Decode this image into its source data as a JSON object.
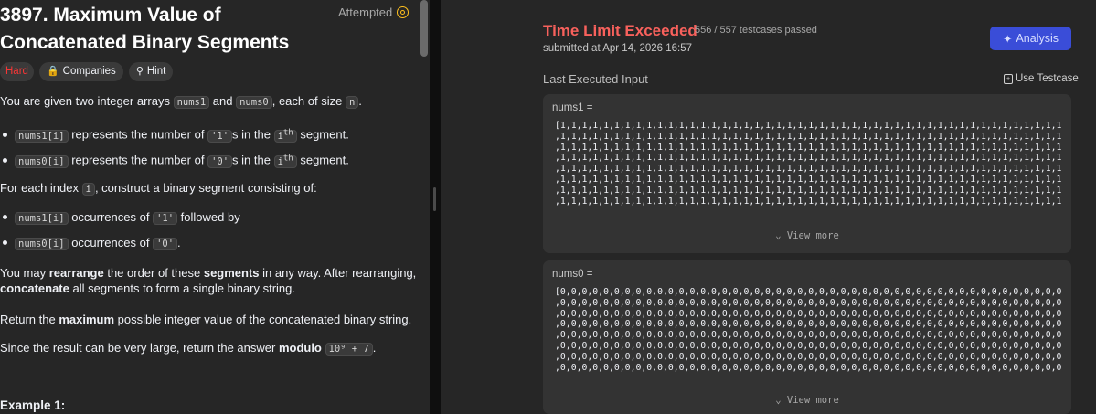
{
  "problem": {
    "title": "3897. Maximum Value of Concatenated Binary Segments",
    "attempted": "Attempted",
    "tags": {
      "difficulty": "Hard",
      "companies": "Companies",
      "hint": "Hint"
    },
    "desc": {
      "p1_a": "You are given two integer arrays ",
      "p1_code1": "nums1",
      "p1_b": " and ",
      "p1_code2": "nums0",
      "p1_c": ", each of size ",
      "p1_code3": "n",
      "p1_d": ".",
      "b1_code": "nums1[i]",
      "b1_a": " represents the number of ",
      "b1_code2": "'1'",
      "b1_b": "s in the ",
      "b1_code3": "i",
      "b1_sup": "th",
      "b1_c": " segment.",
      "b2_code": "nums0[i]",
      "b2_a": " represents the number of ",
      "b2_code2": "'0'",
      "b2_b": "s in the ",
      "b2_code3": "i",
      "b2_sup": "th",
      "b2_c": " segment.",
      "p2_a": "For each index ",
      "p2_code": "i",
      "p2_b": ", construct a binary segment consisting of:",
      "b3_code": "nums1[i]",
      "b3_a": " occurrences of ",
      "b3_code2": "'1'",
      "b3_b": " followed by",
      "b4_code": "nums0[i]",
      "b4_a": " occurrences of ",
      "b4_code2": "'0'",
      "b4_b": ".",
      "p3_a": "You may ",
      "p3_bold1": "rearrange",
      "p3_b": " the order of these ",
      "p3_bold2": "segments",
      "p3_c": " in any way. After rearranging,",
      "p3_bold3": "concatenate",
      "p3_d": " all segments to form a single binary string.",
      "p4_a": "Return the ",
      "p4_bold": "maximum",
      "p4_b": " possible integer value of the concatenated binary string.",
      "p5_a": "Since the result can be very large, return the answer ",
      "p5_bold": "modulo",
      "p5_code": "10⁹ + 7",
      "p5_b": "."
    },
    "example": "Example 1:"
  },
  "result": {
    "status": "Time Limit Exceeded",
    "passed": "556 / 557 testcases passed",
    "submitted": "submitted at Apr 14, 2026 16:57",
    "analysis": "Analysis",
    "last_input": "Last Executed Input",
    "use_testcase": "Use Testcase",
    "nums1_label": "nums1 =",
    "nums1_lines": [
      "[1,1,1,1,1,1,1,1,1,1,1,1,1,1,1,1,1,1,1,1,1,1,1,1,1,1,1,1,1,1,1,1,1,1,1,1,1,1,1,1,1,1,1,1,1,1,1",
      ",1,1,1,1,1,1,1,1,1,1,1,1,1,1,1,1,1,1,1,1,1,1,1,1,1,1,1,1,1,1,1,1,1,1,1,1,1,1,1,1,1,1,1,1,1,1,1",
      ",1,1,1,1,1,1,1,1,1,1,1,1,1,1,1,1,1,1,1,1,1,1,1,1,1,1,1,1,1,1,1,1,1,1,1,1,1,1,1,1,1,1,1,1,1,1,1",
      ",1,1,1,1,1,1,1,1,1,1,1,1,1,1,1,1,1,1,1,1,1,1,1,1,1,1,1,1,1,1,1,1,1,1,1,1,1,1,1,1,1,1,1,1,1,1,1",
      ",1,1,1,1,1,1,1,1,1,1,1,1,1,1,1,1,1,1,1,1,1,1,1,1,1,1,1,1,1,1,1,1,1,1,1,1,1,1,1,1,1,1,1,1,1,1,1",
      ",1,1,1,1,1,1,1,1,1,1,1,1,1,1,1,1,1,1,1,1,1,1,1,1,1,1,1,1,1,1,1,1,1,1,1,1,1,1,1,1,1,1,1,1,1,1,1",
      ",1,1,1,1,1,1,1,1,1,1,1,1,1,1,1,1,1,1,1,1,1,1,1,1,1,1,1,1,1,1,1,1,1,1,1,1,1,1,1,1,1,1,1,1,1,1,1",
      ",1,1,1,1,1,1,1,1,1,1,1,1,1,1,1,1,1,1,1,1,1,1,1,1,1,1,1,1,1,1,1,1,1,1,1,1,1,1,1,1,1,1,1,1,1,1,1"
    ],
    "nums0_label": "nums0 =",
    "nums0_lines": [
      "[0,0,0,0,0,0,0,0,0,0,0,0,0,0,0,0,0,0,0,0,0,0,0,0,0,0,0,0,0,0,0,0,0,0,0,0,0,0,0,0,0,0,0,0,0,0,0",
      ",0,0,0,0,0,0,0,0,0,0,0,0,0,0,0,0,0,0,0,0,0,0,0,0,0,0,0,0,0,0,0,0,0,0,0,0,0,0,0,0,0,0,0,0,0,0,0",
      ",0,0,0,0,0,0,0,0,0,0,0,0,0,0,0,0,0,0,0,0,0,0,0,0,0,0,0,0,0,0,0,0,0,0,0,0,0,0,0,0,0,0,0,0,0,0,0",
      ",0,0,0,0,0,0,0,0,0,0,0,0,0,0,0,0,0,0,0,0,0,0,0,0,0,0,0,0,0,0,0,0,0,0,0,0,0,0,0,0,0,0,0,0,0,0,0",
      ",0,0,0,0,0,0,0,0,0,0,0,0,0,0,0,0,0,0,0,0,0,0,0,0,0,0,0,0,0,0,0,0,0,0,0,0,0,0,0,0,0,0,0,0,0,0,0",
      ",0,0,0,0,0,0,0,0,0,0,0,0,0,0,0,0,0,0,0,0,0,0,0,0,0,0,0,0,0,0,0,0,0,0,0,0,0,0,0,0,0,0,0,0,0,0,0",
      ",0,0,0,0,0,0,0,0,0,0,0,0,0,0,0,0,0,0,0,0,0,0,0,0,0,0,0,0,0,0,0,0,0,0,0,0,0,0,0,0,0,0,0,0,0,0,0",
      ",0,0,0,0,0,0,0,0,0,0,0,0,0,0,0,0,0,0,0,0,0,0,0,0,0,0,0,0,0,0,0,0,0,0,0,0,0,0,0,0,0,0,0,0,0,0,0"
    ],
    "view_more": "View more"
  },
  "colors": {
    "status": "#f8615c",
    "hard": "#f63636",
    "analysis_bg": "#3a4dd8",
    "attempted_icon": "#ffc01e"
  }
}
